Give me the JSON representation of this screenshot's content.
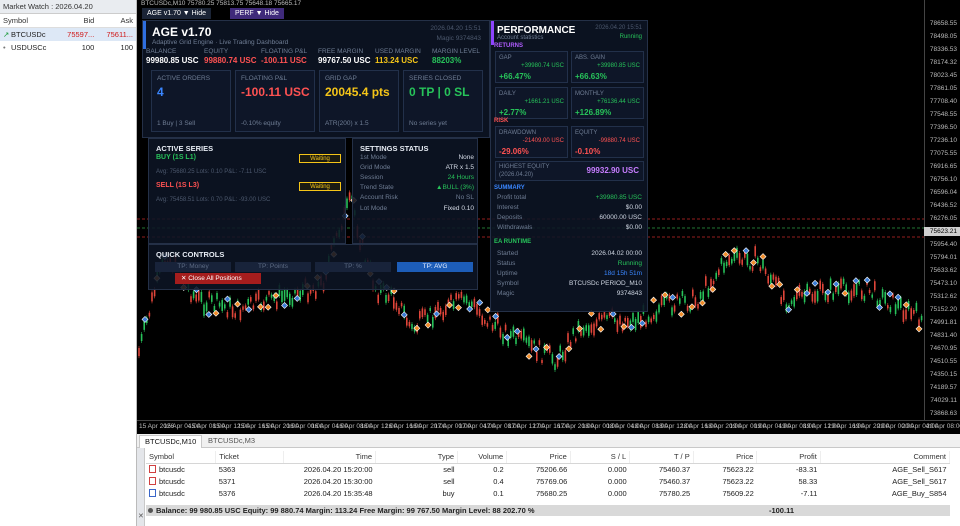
{
  "market_watch": {
    "title": "Market Watch : 2026.04.20",
    "headers": {
      "symbol": "Symbol",
      "bid": "Bid",
      "ask": "Ask"
    },
    "rows": [
      {
        "symbol": "BTCUSDc",
        "bid": "75597...",
        "ask": "75611...",
        "direction": "up"
      },
      {
        "symbol": "USDUSCc",
        "bid": "100",
        "ask": "100",
        "direction": "none"
      }
    ]
  },
  "chart": {
    "topbar": "BTCUSDc,M10  75780.25 75813.75 75648.18 75665.17",
    "title_button": "AGE v1.70  ▼ Hide",
    "perf_button": "PERF  ▼ Hide",
    "price_ticks": [
      "78658.55",
      "78498.05",
      "78336.53",
      "78174.32",
      "78023.45",
      "77861.05",
      "77708.40",
      "77548.55",
      "77396.50",
      "77236.10",
      "77075.55",
      "76916.65",
      "76756.10",
      "76596.04",
      "76436.52",
      "76276.05",
      "76115.50",
      "75954.40",
      "75794.01",
      "75633.62",
      "75473.10",
      "75312.62",
      "75152.20",
      "74991.81",
      "74831.40",
      "74670.95",
      "74510.55",
      "74350.15",
      "74189.57",
      "74029.11",
      "73868.63"
    ],
    "current_price": "75623.21",
    "time_ticks": [
      "15 Apr 2026",
      "15 Apr 04:00",
      "15 Apr 08:00",
      "15 Apr 12:00",
      "15 Apr 16:00",
      "15 Apr 20:00",
      "16 Apr 00:00",
      "16 Apr 04:00",
      "16 Apr 08:00",
      "16 Apr 12:00",
      "16 Apr 16:00",
      "16 Apr 20:00",
      "17 Apr 00:00",
      "17 Apr 04:00",
      "17 Apr 08:00",
      "17 Apr 12:00",
      "17 Apr 16:00",
      "17 Apr 20:00",
      "18 Apr 00:00",
      "18 Apr 04:00",
      "18 Apr 08:00",
      "18 Apr 12:00",
      "18 Apr 16:00",
      "18 Apr 20:00",
      "19 Apr 00:00",
      "19 Apr 04:00",
      "19 Apr 08:00",
      "19 Apr 12:00",
      "19 Apr 16:00",
      "19 Apr 20:00",
      "20 Apr 00:00",
      "20 Apr 04:00",
      "20 Apr 08:00"
    ],
    "colors": {
      "bull": "#27c35a",
      "bear": "#e0453a",
      "marker_buy": "#3a7bd5",
      "marker_sell": "#f08c2a",
      "level_red": "#c62828",
      "level_green": "#2e9d45"
    }
  },
  "main_panel": {
    "brand": "AGE  v1.70",
    "subtitle": "Adaptive Grid Engine  ·  Live Trading Dashboard",
    "date": "2026.04.20 15:51",
    "magic": "Magic 9374843",
    "metrics": [
      {
        "label": "BALANCE",
        "value": "99980.85 USC",
        "color": "#ffffff"
      },
      {
        "label": "EQUITY",
        "value": "99880.74 USC",
        "color": "#ff5252"
      },
      {
        "label": "FLOATING P&L",
        "value": "-100.11 USC",
        "color": "#ff5252"
      },
      {
        "label": "FREE MARGIN",
        "value": "99767.50 USC",
        "color": "#ffffff"
      },
      {
        "label": "USED MARGIN",
        "value": "113.24 USC",
        "color": "#f5c518"
      },
      {
        "label": "MARGIN LEVEL",
        "value": "88203%",
        "color": "#27c35a"
      }
    ],
    "cards": [
      {
        "title": "ACTIVE ORDERS",
        "value": "4",
        "foot": "1 Buy | 3 Sell",
        "color": "#3a86ff"
      },
      {
        "title": "FLOATING P&L",
        "value": "-100.11 USC",
        "foot": "-0.10% equity",
        "color": "#ff5252"
      },
      {
        "title": "GRID GAP",
        "value": "20045.4 pts",
        "foot": "ATR(200) x 1.5",
        "color": "#f5c518"
      },
      {
        "title": "SERIES CLOSED",
        "value": "0 TP | 0 SL",
        "foot": "No series yet",
        "color": "#27c35a"
      }
    ]
  },
  "series_panel": {
    "title": "ACTIVE SERIES",
    "buy": {
      "label": "BUY (1S L1)",
      "status": "Waiting",
      "detail": "Avg: 75680.25  Lots: 0.10  P&L: -7.11 USC"
    },
    "sell": {
      "label": "SELL (1S L3)",
      "status": "Waiting",
      "detail": "Avg: 75458.51  Lots: 0.70  P&L: -93.00 USC"
    }
  },
  "settings_panel": {
    "title": "SETTINGS STATUS",
    "rows": [
      {
        "k": "1st Mode",
        "v": "None"
      },
      {
        "k": "Grid Mode",
        "v": "ATR x 1.5"
      },
      {
        "k": "Session",
        "v": "24 Hours"
      },
      {
        "k": "Trend State",
        "v": "▲BULL (3%)"
      },
      {
        "k": "Account Risk",
        "v": "No SL"
      },
      {
        "k": "Lot Mode",
        "v": "Fixed 0.10"
      }
    ]
  },
  "controls_panel": {
    "title": "QUICK CONTROLS",
    "buttons": [
      "TP: Money",
      "TP: Points",
      "TP: %",
      "TP: AVG"
    ],
    "close_all": "✕  Close All Positions"
  },
  "perf_panel": {
    "title": "PERFORMANCE",
    "subtitle": "Account statistics",
    "date": "2026.04.20 15:51",
    "status": "Running",
    "returns_label": "RETURNS",
    "returns": [
      {
        "label": "GAP",
        "abs": "+39980.74 USC",
        "pct": "+66.47%"
      },
      {
        "label": "ABS. GAIN",
        "abs": "+39980.85 USC",
        "pct": "+66.63%"
      },
      {
        "label": "DAILY",
        "abs": "+1661.21 USC",
        "pct": "+2.77%"
      },
      {
        "label": "MONTHLY",
        "abs": "+76136.44 USC",
        "pct": "+126.89%"
      }
    ],
    "risk_label": "RISK",
    "risk": [
      {
        "label": "DRAWDOWN",
        "abs": "-21409.00 USC",
        "pct": "-29.06%"
      },
      {
        "label": "EQUITY",
        "abs": "-99880.74 USC",
        "pct": "-0.10%"
      }
    ],
    "high": {
      "label": "HIGHEST EQUITY",
      "sub": "(2026.04.20)",
      "value": "99932.90 USC"
    },
    "summary_label": "SUMMARY",
    "summary": [
      {
        "k": "Profit total",
        "v": "+39980.85 USC",
        "color": "#27c35a"
      },
      {
        "k": "Interest",
        "v": "$0.00",
        "color": "#d7dde8"
      },
      {
        "k": "Deposits",
        "v": "60000.00 USC",
        "color": "#d7dde8"
      },
      {
        "k": "Withdrawals",
        "v": "$0.00",
        "color": "#d7dde8"
      }
    ],
    "runtime_label": "EA RUNTIME",
    "runtime": [
      {
        "k": "Started",
        "v": "2026.04.02 00:00",
        "color": "#d7dde8"
      },
      {
        "k": "Status",
        "v": "Running",
        "color": "#27c35a"
      },
      {
        "k": "Uptime",
        "v": "18d 15h 51m",
        "color": "#3a86ff"
      },
      {
        "k": "Symbol",
        "v": "BTCUSDc PERIOD_M10",
        "color": "#d7dde8"
      },
      {
        "k": "Magic",
        "v": "9374843",
        "color": "#d7dde8"
      }
    ]
  },
  "tabs": [
    "BTCUSDc,M10",
    "BTCUSDc,M3"
  ],
  "orders": {
    "columns": [
      "Symbol",
      "Ticket",
      "Time",
      "Type",
      "Volume",
      "Price",
      "S / L",
      "T / P",
      "Price",
      "Profit",
      "Comment"
    ],
    "rows": [
      {
        "symbol": "btcusdc",
        "ticket": "5363",
        "time": "2026.04.20 15:20:00",
        "type": "sell",
        "volume": "0.2",
        "price": "75206.66",
        "sl": "0.000",
        "tp": "75460.37",
        "cur": "75623.22",
        "profit": "-83.31",
        "comment": "AGE_Sell_S617"
      },
      {
        "symbol": "btcusdc",
        "ticket": "5371",
        "time": "2026.04.20 15:30:00",
        "type": "sell",
        "volume": "0.4",
        "price": "75769.06",
        "sl": "0.000",
        "tp": "75460.37",
        "cur": "75623.22",
        "profit": "58.33",
        "comment": "AGE_Sell_S617"
      },
      {
        "symbol": "btcusdc",
        "ticket": "5376",
        "time": "2026.04.20 15:35:48",
        "type": "buy",
        "volume": "0.1",
        "price": "75680.25",
        "sl": "0.000",
        "tp": "75780.25",
        "cur": "75609.22",
        "profit": "-7.11",
        "comment": "AGE_Buy_S854"
      }
    ],
    "summary": "Balance: 99 980.85 USC  Equity: 99 880.74  Margin: 113.24  Free Margin: 99 767.50  Margin Level: 88 202.70 %",
    "total": "-100.11"
  }
}
